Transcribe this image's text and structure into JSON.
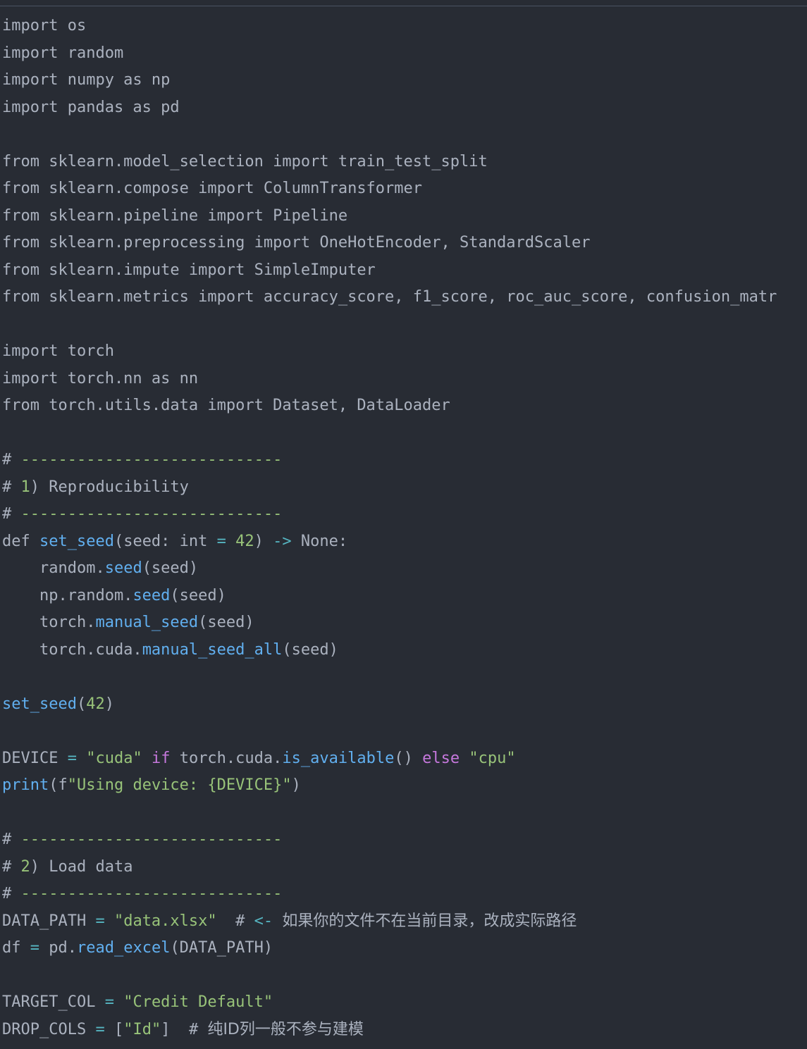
{
  "editor": {
    "theme_colors": {
      "background": "#282c34",
      "plain": "#abb2bf",
      "keyword": "#c678dd",
      "function": "#61afef",
      "string": "#98c379",
      "number": "#98c379",
      "operator": "#56b6c2",
      "comment": "#7f848e"
    },
    "lines": [
      {
        "tokens": [
          {
            "t": "plain",
            "v": "import os"
          }
        ]
      },
      {
        "tokens": [
          {
            "t": "plain",
            "v": "import random"
          }
        ]
      },
      {
        "tokens": [
          {
            "t": "plain",
            "v": "import numpy as np"
          }
        ]
      },
      {
        "tokens": [
          {
            "t": "plain",
            "v": "import pandas as pd"
          }
        ]
      },
      {
        "tokens": []
      },
      {
        "tokens": [
          {
            "t": "plain",
            "v": "from sklearn.model_selection import train_test_split"
          }
        ]
      },
      {
        "tokens": [
          {
            "t": "plain",
            "v": "from sklearn.compose import ColumnTransformer"
          }
        ]
      },
      {
        "tokens": [
          {
            "t": "plain",
            "v": "from sklearn.pipeline import Pipeline"
          }
        ]
      },
      {
        "tokens": [
          {
            "t": "plain",
            "v": "from sklearn.preprocessing import OneHotEncoder, StandardScaler"
          }
        ]
      },
      {
        "tokens": [
          {
            "t": "plain",
            "v": "from sklearn.impute import SimpleImputer"
          }
        ]
      },
      {
        "tokens": [
          {
            "t": "plain",
            "v": "from sklearn.metrics import accuracy_score, f1_score, roc_auc_score, confusion_matr"
          }
        ]
      },
      {
        "tokens": []
      },
      {
        "tokens": [
          {
            "t": "plain",
            "v": "import torch"
          }
        ]
      },
      {
        "tokens": [
          {
            "t": "plain",
            "v": "import torch.nn as nn"
          }
        ]
      },
      {
        "tokens": [
          {
            "t": "plain",
            "v": "from torch.utils.data import Dataset, DataLoader"
          }
        ]
      },
      {
        "tokens": []
      },
      {
        "tokens": [
          {
            "t": "comment-text",
            "v": "# "
          },
          {
            "t": "dashes",
            "v": "----------------------------"
          }
        ]
      },
      {
        "tokens": [
          {
            "t": "comment-text",
            "v": "# "
          },
          {
            "t": "number",
            "v": "1"
          },
          {
            "t": "comment-text",
            "v": ") Reproducibility"
          }
        ]
      },
      {
        "tokens": [
          {
            "t": "comment-text",
            "v": "# "
          },
          {
            "t": "dashes",
            "v": "----------------------------"
          }
        ]
      },
      {
        "tokens": [
          {
            "t": "plain",
            "v": "def "
          },
          {
            "t": "function",
            "v": "set_seed"
          },
          {
            "t": "plain",
            "v": "(seed: int "
          },
          {
            "t": "operator",
            "v": "="
          },
          {
            "t": "plain",
            "v": " "
          },
          {
            "t": "number",
            "v": "42"
          },
          {
            "t": "plain",
            "v": ") "
          },
          {
            "t": "operator",
            "v": "->"
          },
          {
            "t": "plain",
            "v": " None:"
          }
        ]
      },
      {
        "tokens": [
          {
            "t": "plain",
            "v": "    random."
          },
          {
            "t": "function",
            "v": "seed"
          },
          {
            "t": "plain",
            "v": "(seed)"
          }
        ]
      },
      {
        "tokens": [
          {
            "t": "plain",
            "v": "    np.random."
          },
          {
            "t": "function",
            "v": "seed"
          },
          {
            "t": "plain",
            "v": "(seed)"
          }
        ]
      },
      {
        "tokens": [
          {
            "t": "plain",
            "v": "    torch."
          },
          {
            "t": "function",
            "v": "manual_seed"
          },
          {
            "t": "plain",
            "v": "(seed)"
          }
        ]
      },
      {
        "tokens": [
          {
            "t": "plain",
            "v": "    torch.cuda."
          },
          {
            "t": "function",
            "v": "manual_seed_all"
          },
          {
            "t": "plain",
            "v": "(seed)"
          }
        ]
      },
      {
        "tokens": []
      },
      {
        "tokens": [
          {
            "t": "function",
            "v": "set_seed"
          },
          {
            "t": "plain",
            "v": "("
          },
          {
            "t": "number",
            "v": "42"
          },
          {
            "t": "plain",
            "v": ")"
          }
        ]
      },
      {
        "tokens": []
      },
      {
        "tokens": [
          {
            "t": "plain",
            "v": "DEVICE "
          },
          {
            "t": "operator",
            "v": "="
          },
          {
            "t": "plain",
            "v": " "
          },
          {
            "t": "string",
            "v": "\"cuda\""
          },
          {
            "t": "plain",
            "v": " "
          },
          {
            "t": "keyword",
            "v": "if"
          },
          {
            "t": "plain",
            "v": " torch.cuda."
          },
          {
            "t": "function",
            "v": "is_available"
          },
          {
            "t": "plain",
            "v": "() "
          },
          {
            "t": "keyword",
            "v": "else"
          },
          {
            "t": "plain",
            "v": " "
          },
          {
            "t": "string",
            "v": "\"cpu\""
          }
        ]
      },
      {
        "tokens": [
          {
            "t": "function",
            "v": "print"
          },
          {
            "t": "plain",
            "v": "(f"
          },
          {
            "t": "string",
            "v": "\"Using device: {DEVICE}\""
          },
          {
            "t": "plain",
            "v": ")"
          }
        ]
      },
      {
        "tokens": []
      },
      {
        "tokens": [
          {
            "t": "comment-text",
            "v": "# "
          },
          {
            "t": "dashes",
            "v": "----------------------------"
          }
        ]
      },
      {
        "tokens": [
          {
            "t": "comment-text",
            "v": "# "
          },
          {
            "t": "number",
            "v": "2"
          },
          {
            "t": "comment-text",
            "v": ") Load data"
          }
        ]
      },
      {
        "tokens": [
          {
            "t": "comment-text",
            "v": "# "
          },
          {
            "t": "dashes",
            "v": "----------------------------"
          }
        ]
      },
      {
        "tokens": [
          {
            "t": "plain",
            "v": "DATA_PATH "
          },
          {
            "t": "operator",
            "v": "="
          },
          {
            "t": "plain",
            "v": " "
          },
          {
            "t": "string",
            "v": "\"data.xlsx\""
          },
          {
            "t": "plain",
            "v": "  "
          },
          {
            "t": "comment-text",
            "v": "# "
          },
          {
            "t": "operator",
            "v": "<-"
          },
          {
            "t": "plain",
            "v": " "
          },
          {
            "t": "cjk",
            "v": "如果你的文件不在当前目录，改成实际路径"
          }
        ]
      },
      {
        "tokens": [
          {
            "t": "plain",
            "v": "df "
          },
          {
            "t": "operator",
            "v": "="
          },
          {
            "t": "plain",
            "v": " pd."
          },
          {
            "t": "function",
            "v": "read_excel"
          },
          {
            "t": "plain",
            "v": "(DATA_PATH)"
          }
        ]
      },
      {
        "tokens": []
      },
      {
        "tokens": [
          {
            "t": "plain",
            "v": "TARGET_COL "
          },
          {
            "t": "operator",
            "v": "="
          },
          {
            "t": "plain",
            "v": " "
          },
          {
            "t": "string",
            "v": "\"Credit Default\""
          }
        ]
      },
      {
        "tokens": [
          {
            "t": "plain",
            "v": "DROP_COLS "
          },
          {
            "t": "operator",
            "v": "="
          },
          {
            "t": "plain",
            "v": " ["
          },
          {
            "t": "string",
            "v": "\"Id\""
          },
          {
            "t": "plain",
            "v": "]  "
          },
          {
            "t": "comment-text",
            "v": "# "
          },
          {
            "t": "cjk",
            "v": "纯ID列一般不参与建模"
          }
        ]
      }
    ]
  }
}
